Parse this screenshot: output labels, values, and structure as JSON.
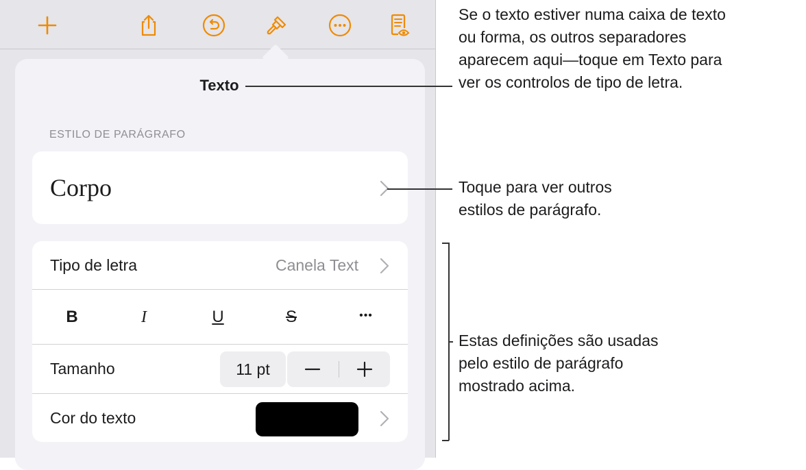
{
  "toolbar": {
    "buttons": [
      {
        "name": "add-button",
        "icon": "plus-icon"
      },
      {
        "name": "share-button",
        "icon": "share-icon"
      },
      {
        "name": "undo-button",
        "icon": "undo-icon"
      },
      {
        "name": "format-button",
        "icon": "paintbrush-icon"
      },
      {
        "name": "more-button",
        "icon": "ellipsis-circle-icon"
      },
      {
        "name": "reading-view-button",
        "icon": "document-eye-icon"
      }
    ],
    "accent_color": "#f08a00"
  },
  "panel": {
    "title": "Texto",
    "paragraph_style_header": "ESTILO DE PARÁGRAFO",
    "paragraph_style": "Corpo",
    "font_label": "Tipo de letra",
    "font_value": "Canela Text",
    "format_buttons": {
      "bold": "B",
      "italic": "I",
      "underline": "U",
      "strikethrough": "S",
      "more": "•••"
    },
    "size_label": "Tamanho",
    "size_value": "11 pt",
    "color_label": "Cor do texto",
    "text_color": "#000000"
  },
  "callouts": {
    "tabs_note": "Se o texto estiver numa caixa de texto\nou forma, os outros separadores\naparecem aqui—toque em Texto para\nver os controlos de tipo de letra.",
    "style_note": "Toque para ver outros\nestilos de parágrafo.",
    "settings_note": "Estas definições são usadas\npelo estilo de parágrafo\nmostrado acima."
  }
}
